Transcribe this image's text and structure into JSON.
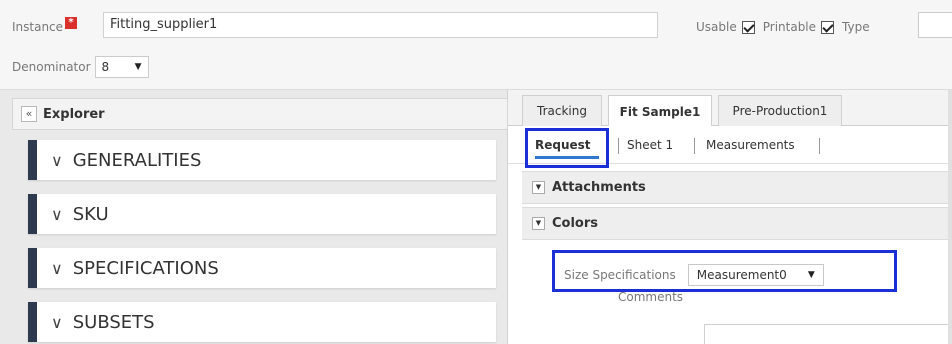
{
  "header": {
    "instance_label": "Instance",
    "required_mark": "*",
    "instance_value": "Fitting_supplier1",
    "usable_label": "Usable",
    "printable_label": "Printable",
    "type_label": "Type",
    "denominator_label": "Denominator",
    "denominator_value": "8"
  },
  "explorer": {
    "collapse_icon": "«",
    "title": "Explorer",
    "sections": [
      {
        "label": "GENERALITIES"
      },
      {
        "label": "SKU"
      },
      {
        "label": "SPECIFICATIONS"
      },
      {
        "label": "SUBSETS"
      }
    ]
  },
  "tabs": [
    {
      "label": "Tracking"
    },
    {
      "label": "Fit Sample1"
    },
    {
      "label": "Pre-Production1"
    }
  ],
  "subtabs": [
    {
      "label": "Request"
    },
    {
      "label": "Sheet 1"
    },
    {
      "label": "Measurements"
    }
  ],
  "accordions": {
    "attachments": "Attachments",
    "colors": "Colors"
  },
  "form": {
    "size_spec_label": "Size Specifications",
    "size_spec_value": "Measurement0",
    "comments_label": "Comments"
  },
  "colors": {
    "highlight": "#1a2fd6",
    "section_bar": "#2e3b4e",
    "active_underline": "#2f78d0",
    "required": "#d9302c"
  }
}
